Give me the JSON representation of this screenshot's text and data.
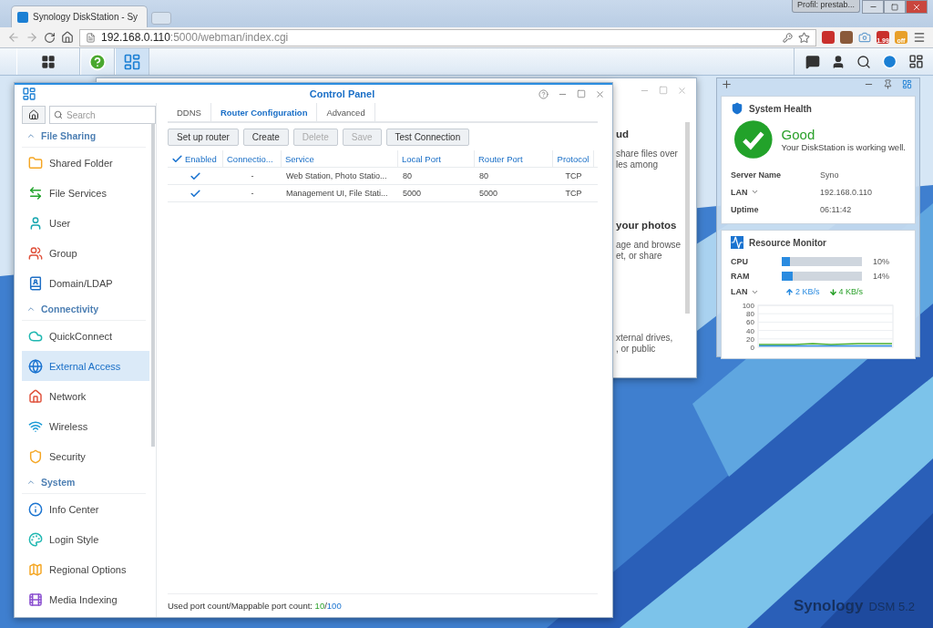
{
  "browser": {
    "tab_title": "Synology DiskStation - Sy",
    "profile": "Profil: prestab...",
    "url_host": "192.168.0.110",
    "url_path": ":5000/webman/index.cgi",
    "badges": [
      "1.99",
      "off"
    ]
  },
  "taskbar": {
    "apps": [
      {
        "kind": "main-menu",
        "selected": false
      },
      {
        "kind": "help",
        "selected": false
      },
      {
        "kind": "control-panel",
        "selected": true
      }
    ]
  },
  "background_window": {
    "lines": [
      {
        "kind": "heading",
        "text": "ud"
      },
      {
        "kind": "text",
        "text": "share files over"
      },
      {
        "kind": "text",
        "text": "les among"
      },
      {
        "kind": "heading",
        "text": "your photos"
      },
      {
        "kind": "text",
        "text": "age and browse"
      },
      {
        "kind": "text",
        "text": "et, or share"
      },
      {
        "kind": "text",
        "text": "xternal drives,"
      },
      {
        "kind": "text",
        "text": ", or public"
      }
    ]
  },
  "control_panel": {
    "title": "Control Panel",
    "search": {
      "placeholder": "Search"
    },
    "sidebar": [
      {
        "section": "File Sharing",
        "expanded": true,
        "items": [
          {
            "label": "Shared Folder",
            "kind": "folder",
            "selected": false
          },
          {
            "label": "File Services",
            "kind": "services",
            "selected": false
          },
          {
            "label": "User",
            "kind": "user",
            "selected": false
          },
          {
            "label": "Group",
            "kind": "group",
            "selected": false
          },
          {
            "label": "Domain/LDAP",
            "kind": "directory",
            "selected": false
          }
        ]
      },
      {
        "section": "Connectivity",
        "expanded": true,
        "items": [
          {
            "label": "QuickConnect",
            "kind": "cloud",
            "selected": false
          },
          {
            "label": "External Access",
            "kind": "globe",
            "selected": true
          },
          {
            "label": "Network",
            "kind": "network",
            "selected": false
          },
          {
            "label": "Wireless",
            "kind": "wireless",
            "selected": false
          },
          {
            "label": "Security",
            "kind": "shield",
            "selected": false
          }
        ]
      },
      {
        "section": "System",
        "expanded": true,
        "items": [
          {
            "label": "Info Center",
            "kind": "info",
            "selected": false
          },
          {
            "label": "Login Style",
            "kind": "palette",
            "selected": false
          },
          {
            "label": "Regional Options",
            "kind": "map",
            "selected": false
          },
          {
            "label": "Media Indexing",
            "kind": "film",
            "selected": false
          }
        ]
      }
    ],
    "tabs": [
      {
        "label": "DDNS",
        "selected": false
      },
      {
        "label": "Router Configuration",
        "selected": true
      },
      {
        "label": "Advanced",
        "selected": false
      }
    ],
    "toolbar": [
      {
        "label": "Set up router",
        "disabled": false
      },
      {
        "label": "Create",
        "disabled": false
      },
      {
        "label": "Delete",
        "disabled": true
      },
      {
        "label": "Save",
        "disabled": true
      },
      {
        "label": "Test Connection",
        "disabled": false
      }
    ],
    "table": {
      "header_checked": true,
      "columns": [
        "Enabled",
        "Connectio...",
        "Service",
        "Local Port",
        "Router Port",
        "Protocol"
      ],
      "rows": [
        {
          "enabled": true,
          "connection": "-",
          "service": "Web Station, Photo Statio...",
          "local_port": "80",
          "router_port": "80",
          "protocol": "TCP"
        },
        {
          "enabled": true,
          "connection": "-",
          "service": "Management UI, File Stati...",
          "local_port": "5000",
          "router_port": "5000",
          "protocol": "TCP"
        }
      ]
    },
    "footer": {
      "label": "Used port count/Mappable port count:",
      "used": "10",
      "separator": "/",
      "total": "100"
    }
  },
  "widgets": {
    "health": {
      "title": "System Health",
      "status": "Good",
      "message": "Your DiskStation is working well.",
      "rows": [
        {
          "label": "Server Name",
          "value": "Syno",
          "dropdown": false
        },
        {
          "label": "LAN",
          "value": "192.168.0.110",
          "dropdown": true
        },
        {
          "label": "Uptime",
          "value": "06:11:42",
          "dropdown": false
        }
      ]
    },
    "monitor": {
      "title": "Resource Monitor",
      "meters": [
        {
          "label": "CPU",
          "level": 0.1,
          "reading": "10%"
        },
        {
          "label": "RAM",
          "level": 0.14,
          "reading": "14%"
        }
      ],
      "lan": "LAN",
      "upload": "2 KB/s",
      "download": "4 KB/s",
      "axis_labels": [
        "100",
        "80",
        "60",
        "40",
        "20",
        "0"
      ]
    }
  },
  "logo": {
    "brand": "Synology",
    "version": "DSM 5.2"
  }
}
